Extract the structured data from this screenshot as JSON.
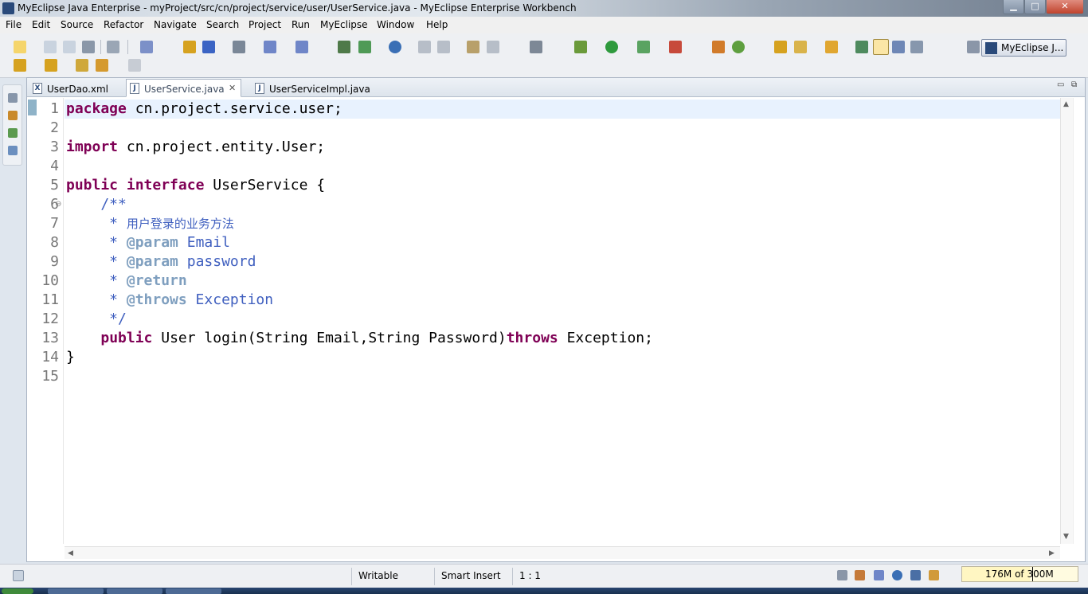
{
  "window": {
    "title": "MyEclipse Java Enterprise - myProject/src/cn/project/service/user/UserService.java - MyEclipse Enterprise Workbench",
    "minimize": "▁",
    "maximize": "□",
    "close": "✕"
  },
  "menu": [
    "File",
    "Edit",
    "Source",
    "Refactor",
    "Navigate",
    "Search",
    "Project",
    "Run",
    "MyEclipse",
    "Window",
    "Help"
  ],
  "perspective": {
    "label": "MyEclipse J..."
  },
  "tabs": [
    {
      "label": "UserDao.xml",
      "icon": "X"
    },
    {
      "label": "UserService.java",
      "icon": "J",
      "close": "✕"
    },
    {
      "label": "UserServiceImpl.java",
      "icon": "J"
    }
  ],
  "tab_controls": {
    "minimize": "▭",
    "maximize": "⧉"
  },
  "editor": {
    "line_numbers": [
      "1",
      "2",
      "3",
      "4",
      "5",
      "6",
      "7",
      "8",
      "9",
      "10",
      "11",
      "12",
      "13",
      "14",
      "15"
    ],
    "lines": {
      "l1": {
        "kw": "package",
        "rest": " cn.project.service.user;"
      },
      "l3": {
        "kw": "import",
        "rest": " cn.project.entity.User;"
      },
      "l5": {
        "kw1": "public",
        "kw2": "interface",
        "rest": " UserService {"
      },
      "l6": {
        "text": "    /**"
      },
      "l7": {
        "star": "     * ",
        "text": "用户登录的业务方法"
      },
      "l8": {
        "star": "     * ",
        "tag": "@param",
        "rest": " Email"
      },
      "l9": {
        "star": "     * ",
        "tag": "@param",
        "rest": " password"
      },
      "l10": {
        "star": "     * ",
        "tag": "@return",
        "rest": ""
      },
      "l11": {
        "star": "     * ",
        "tag": "@throws",
        "rest": " Exception"
      },
      "l12": {
        "text": "     */"
      },
      "l13": {
        "indent": "    ",
        "kw": "public",
        "mid": " User login(String Email,String Password)",
        "kw2": "throws",
        "rest": " Exception;"
      },
      "l14": {
        "text": "}"
      }
    },
    "fold_marker": "⊖"
  },
  "status": {
    "writable": "Writable",
    "insert_mode": "Smart Insert",
    "position": "1 : 1",
    "heap": "176M of 300M",
    "heap_used_fraction": 0.587
  }
}
